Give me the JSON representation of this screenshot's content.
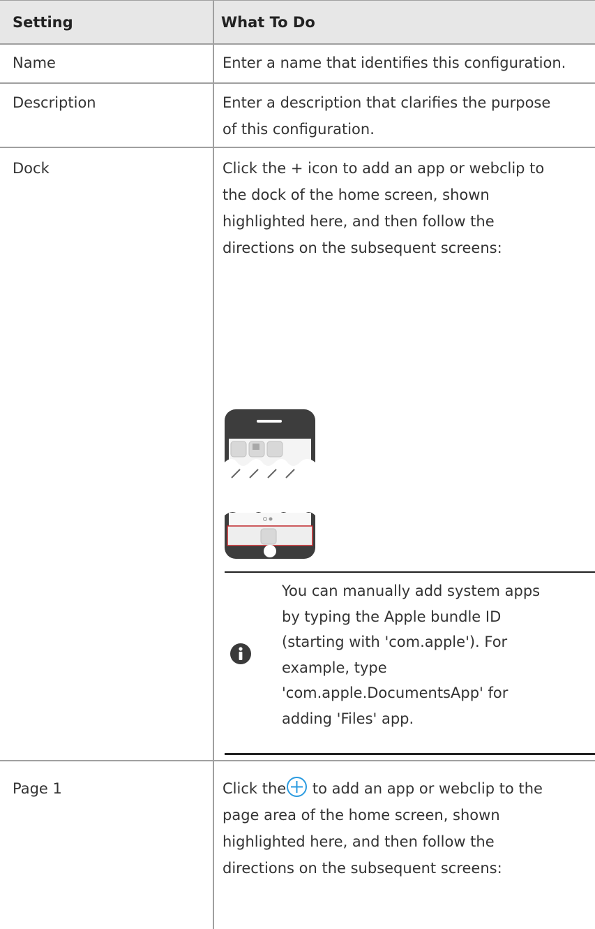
{
  "table": {
    "headers": [
      "Setting",
      "What To Do"
    ],
    "rows": [
      {
        "setting": "Name",
        "what_to_do": "Enter a name that identifies this configuration."
      },
      {
        "setting": "Description",
        "what_to_do_lines": [
          "Enter a description that clarifies the purpose",
          "of this configuration."
        ]
      },
      {
        "setting": "Dock",
        "what_to_do_lines": [
          "Click the + icon to add an app or webclip to",
          "the dock of the home screen, shown",
          "highlighted here, and then follow the",
          "directions on the subsequent screens:"
        ]
      },
      {
        "setting": "Page 1",
        "what_to_do_prefix": "Click the",
        "what_to_do_lines": [
          "to add an app or webclip to the",
          "page area of the home screen, shown",
          "highlighted here, and then follow the",
          "directions on the subsequent screens:"
        ]
      }
    ]
  },
  "note": {
    "icon": "info-icon",
    "lines": [
      "You can manually add system apps",
      "by typing the Apple bundle ID",
      "(starting with 'com.apple'). For",
      "example, type",
      "'com.apple.DocumentsApp' for",
      "adding 'Files' app."
    ]
  },
  "icons": {
    "phone": "phone-dock-illustration",
    "plus": "plus-circle-icon"
  },
  "colors": {
    "header_bg": "#e7e7e7",
    "border": "#a0a0a0",
    "phone_body": "#3d3d3d",
    "highlight": "#c0282d",
    "plus_blue": "#2b9be0"
  }
}
